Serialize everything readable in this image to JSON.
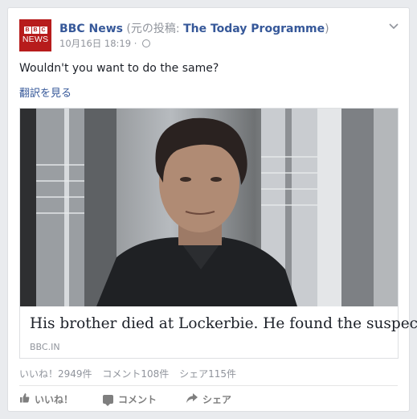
{
  "post": {
    "page_name": "BBC News",
    "shared_prefix": "(元の投稿: ",
    "original_page": "The Today Programme",
    "shared_suffix": ")",
    "timestamp": "10月16日 18:19",
    "separator": "·",
    "text": "Wouldn't you want to do the same?",
    "translate_link": "翻訳を見る"
  },
  "avatar": {
    "letters": [
      "B",
      "B",
      "C"
    ],
    "word": "NEWS",
    "color": "#b71c1c"
  },
  "link": {
    "title": "His brother died at Lockerbie. He found the suspects.",
    "domain": "BBC.IN"
  },
  "stats": {
    "likes": "いいね！2949件",
    "comments": "コメント108件",
    "shares": "シェア115件"
  },
  "actions": {
    "like": "いいね！",
    "comment": "コメント",
    "share": "シェア"
  },
  "icons": {
    "menu": "chevron-down-icon",
    "privacy": "globe-icon",
    "like": "thumbs-up-icon",
    "comment": "comment-icon",
    "share": "share-arrow-icon"
  },
  "colors": {
    "link": "#365899",
    "meta": "#90949c",
    "text": "#1d2129",
    "background": "#e9ebee"
  }
}
